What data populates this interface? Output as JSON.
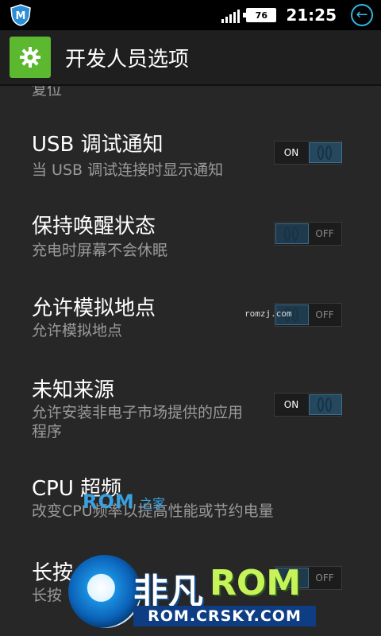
{
  "status_bar": {
    "time": "21:25",
    "battery_level": "76",
    "app_icon": "shield-m-icon",
    "back_icon": "back-arrow-icon"
  },
  "action_bar": {
    "title": "开发人员选项",
    "icon": "gear-icon"
  },
  "settings": {
    "partial_item_subtitle": "复位",
    "items": [
      {
        "title": "USB 调试通知",
        "subtitle": "当 USB 调试连接时显示通知",
        "toggle_label": "ON",
        "state": "on"
      },
      {
        "title": "保持唤醒状态",
        "subtitle": "充电时屏幕不会休眠",
        "toggle_label": "OFF",
        "state": "off"
      },
      {
        "title": "允许模拟地点",
        "subtitle": "允许模拟地点",
        "toggle_label": "OFF",
        "state": "off"
      },
      {
        "title": "未知来源",
        "subtitle": "允许安装非电子市场提供的应用",
        "subtitle2": "程序",
        "toggle_label": "ON",
        "state": "on"
      },
      {
        "title": "CPU 超频",
        "subtitle": "改变CPU频率以提高性能或节约电量"
      },
      {
        "title": "长按",
        "subtitle": "长按",
        "toggle_label": "OFF",
        "state": "off"
      }
    ]
  },
  "watermarks": {
    "small": "romzj.com",
    "rom_logo": "ROM",
    "rom_logo_sub": "之家",
    "brand_cn": "非凡",
    "brand_en": "ROM",
    "url": "ROM.CRSKY.COM"
  },
  "colors": {
    "accent": "#33b5e5",
    "app_icon_bg": "#5cb82f",
    "background": "#272727"
  }
}
